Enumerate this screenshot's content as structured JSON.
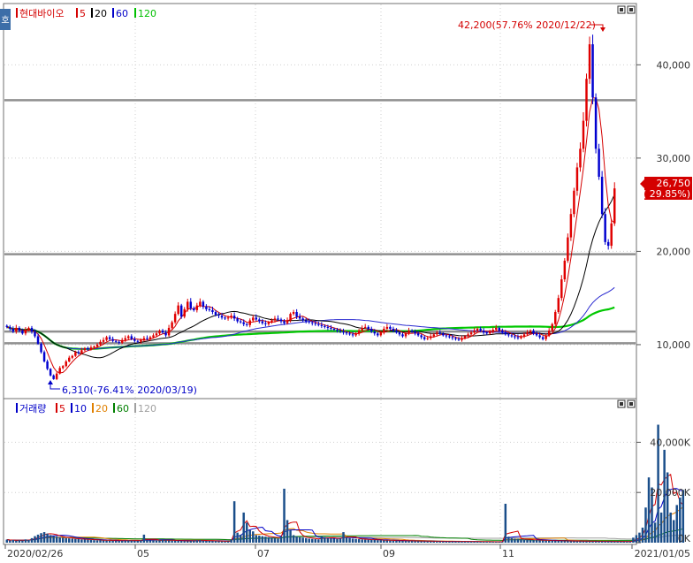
{
  "side_label": "호",
  "price_panel": {
    "legend": [
      {
        "label": "현대바이오",
        "color": "#d40000"
      },
      {
        "label": "5",
        "color": "#d40000"
      },
      {
        "label": "20",
        "color": "#000000"
      },
      {
        "label": "60",
        "color": "#0000c8"
      },
      {
        "label": "120",
        "color": "#00c000"
      }
    ],
    "high_annotation": "42,200(57.76% 2020/12/22)",
    "low_annotation": "6,310(-76.41% 2020/03/19)",
    "current_price": "26,750",
    "current_change": "( 29.85%)"
  },
  "volume_panel": {
    "legend": [
      {
        "label": "거래량",
        "color": "#0000c8"
      },
      {
        "label": "5",
        "color": "#d40000"
      },
      {
        "label": "10",
        "color": "#0000c8"
      },
      {
        "label": "20",
        "color": "#e08000"
      },
      {
        "label": "60",
        "color": "#008000"
      },
      {
        "label": "120",
        "color": "#a0a0a0"
      }
    ]
  },
  "colors": {
    "up": "#e00000",
    "down": "#0000d0",
    "volume_bar": "#1a4e8a",
    "hline": "#909090"
  },
  "chart_data": {
    "type": "candlestick",
    "x_tick_labels": [
      "2020/02/26",
      "05",
      "07",
      "09",
      "11",
      "2021/01/05"
    ],
    "price_axis": {
      "ticks": [
        10000,
        20000,
        30000,
        40000
      ],
      "tick_labels": [
        "10,000",
        "20,000",
        "30,000",
        "40,000"
      ],
      "ylim": [
        4500,
        46000
      ]
    },
    "volume_axis": {
      "ticks": [
        0,
        20000,
        40000
      ],
      "tick_labels": [
        "0K",
        "20,000K",
        "40,000K"
      ],
      "ylim": [
        0,
        50000
      ]
    },
    "horizontal_lines": [
      36200,
      19700,
      11400,
      10150
    ],
    "closes": [
      11900,
      11700,
      11400,
      11800,
      11500,
      11200,
      11600,
      11800,
      11400,
      10900,
      10100,
      9200,
      8200,
      7400,
      6700,
      6310,
      6900,
      7500,
      7700,
      8200,
      8600,
      8800,
      9200,
      9100,
      9400,
      9600,
      9500,
      9700,
      9800,
      10000,
      10300,
      10500,
      10800,
      10600,
      10400,
      10300,
      10200,
      10500,
      10700,
      10900,
      10600,
      10400,
      10300,
      10500,
      10700,
      10600,
      10800,
      11000,
      11200,
      11500,
      11300,
      11000,
      11800,
      12400,
      13300,
      14200,
      13000,
      13800,
      14600,
      13900,
      13700,
      14200,
      14600,
      14100,
      13800,
      13700,
      13500,
      13200,
      13100,
      12900,
      12800,
      12900,
      13100,
      12800,
      12500,
      12400,
      12200,
      12100,
      12600,
      12900,
      12700,
      12500,
      12300,
      12200,
      12400,
      12600,
      12800,
      12700,
      12500,
      12300,
      12600,
      13300,
      13500,
      13000,
      12800,
      12600,
      12500,
      12400,
      12300,
      12200,
      12100,
      12000,
      11900,
      11800,
      11700,
      11600,
      11500,
      11400,
      11300,
      11200,
      11100,
      11000,
      11200,
      11500,
      11800,
      11900,
      11700,
      11400,
      11200,
      11000,
      11300,
      11700,
      11900,
      11700,
      11500,
      11300,
      11100,
      10900,
      11200,
      11500,
      11400,
      11200,
      11000,
      10800,
      10600,
      10700,
      10900,
      11100,
      11300,
      11200,
      11000,
      10900,
      10800,
      10700,
      10600,
      10500,
      10700,
      10900,
      11100,
      11300,
      11500,
      11700,
      11500,
      11300,
      11200,
      11400,
      11600,
      11800,
      11500,
      11300,
      11100,
      11000,
      10900,
      10800,
      10700,
      10900,
      11100,
      11300,
      11500,
      11200,
      11000,
      10800,
      10600,
      11000,
      11500,
      12200,
      13500,
      15000,
      17000,
      19000,
      21500,
      24000,
      26500,
      29000,
      31000,
      34000,
      38500,
      42200,
      36500,
      31000,
      28000,
      24000,
      21000,
      20600,
      23000,
      26750
    ],
    "volumes": [
      1200,
      900,
      1100,
      800,
      1000,
      900,
      1300,
      1100,
      1800,
      2600,
      3200,
      3800,
      4200,
      3600,
      3000,
      2600,
      2400,
      2200,
      2000,
      1800,
      1700,
      1600,
      1500,
      1400,
      1300,
      1300,
      1200,
      1100,
      1000,
      950,
      1000,
      900,
      850,
      800,
      800,
      750,
      700,
      750,
      800,
      850,
      800,
      750,
      700,
      900,
      3200,
      1000,
      900,
      850,
      800,
      950,
      1100,
      1000,
      900,
      850,
      800,
      750,
      700,
      650,
      600,
      700,
      800,
      900,
      1000,
      800,
      700,
      700,
      600,
      650,
      550,
      500,
      480,
      520,
      1200,
      16500,
      4000,
      3200,
      12000,
      8000,
      5000,
      4500,
      3000,
      2800,
      2600,
      2400,
      2200,
      2000,
      1800,
      1600,
      2500,
      21500,
      9000,
      5000,
      3000,
      2500,
      2200,
      2000,
      1800,
      1600,
      1500,
      1400,
      1300,
      2600,
      2200,
      1800,
      1700,
      1600,
      1500,
      1700,
      4200,
      2200,
      1800,
      1600,
      1500,
      1400,
      1300,
      1200,
      1200,
      1100,
      1100,
      1000,
      1000,
      950,
      900,
      850,
      800,
      800,
      750,
      700,
      700,
      650,
      650,
      600,
      600,
      560,
      560,
      520,
      520,
      500,
      500,
      480,
      480,
      460,
      460,
      440,
      440,
      420,
      420,
      400,
      400,
      380,
      380,
      360,
      360,
      340,
      340,
      320,
      300,
      280,
      260,
      300,
      15500,
      2400,
      1800,
      1600,
      1500,
      1400,
      1300,
      1200,
      1100,
      1000,
      1000,
      950,
      900,
      850,
      800,
      800,
      750,
      700,
      700,
      650,
      650,
      600,
      600,
      560,
      560,
      520,
      520,
      500,
      500,
      480,
      480,
      460,
      460,
      440,
      440,
      420,
      420,
      400,
      400,
      380,
      380,
      2000,
      3000,
      4000,
      6000,
      14000,
      26000,
      22000,
      8000,
      47000,
      12000,
      37000,
      28000,
      12000,
      9000,
      15000,
      18000,
      21000
    ]
  }
}
